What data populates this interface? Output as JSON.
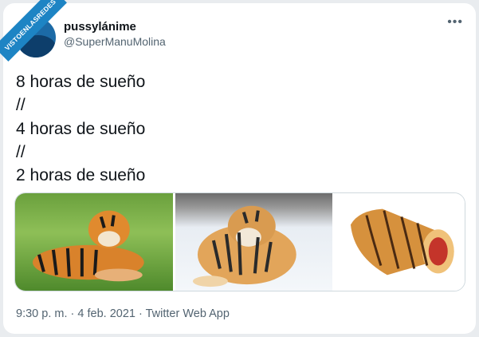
{
  "watermark": "VISTOENLASREDES",
  "author": {
    "display_name": "pussylánime",
    "handle": "@SuperManuMolina"
  },
  "more_icon": "more-horizontal-icon",
  "tweet": {
    "lines": [
      "8 horas de sueño",
      "//",
      "4 horas de sueño",
      "//",
      "2 horas de sueño"
    ]
  },
  "media": [
    {
      "subject": "tiger lying on grass"
    },
    {
      "subject": "tiger lying in snow"
    },
    {
      "subject": "tiger-striped swiss roll cake"
    }
  ],
  "meta": {
    "time": "9:30 p. m.",
    "separator": "·",
    "date": "4 feb. 2021",
    "source": "Twitter Web App"
  },
  "colors": {
    "secondary_text": "#536471",
    "badge": "#1d84c4"
  }
}
